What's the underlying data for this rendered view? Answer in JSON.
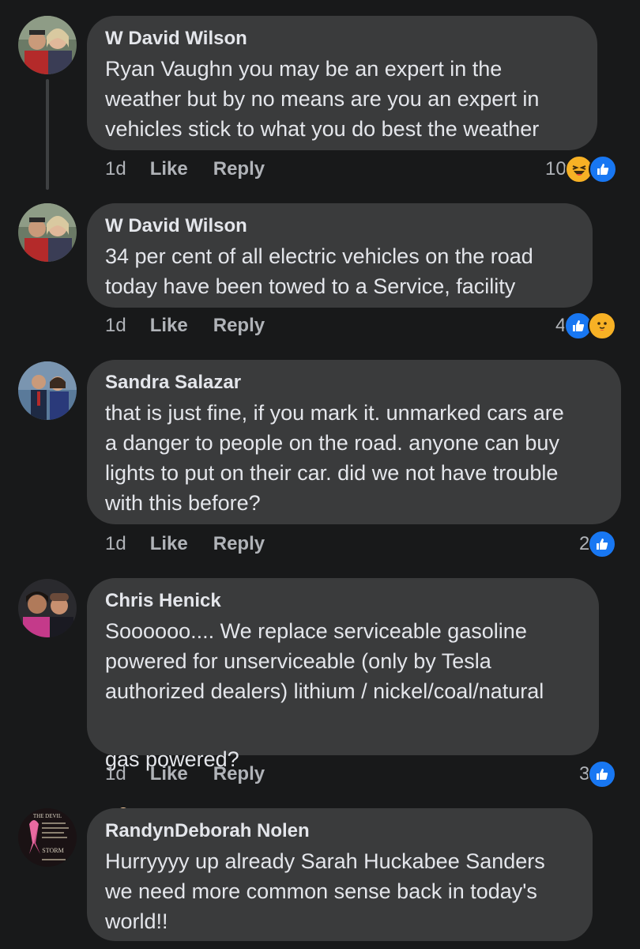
{
  "comments": [
    {
      "author": "W David Wilson",
      "text": "Ryan Vaughn you may be an expert in the\nweather but by no means are you an expert in\nvehicles stick to what you do best the weather",
      "time": "1d",
      "like_label": "Like",
      "reply_label": "Reply",
      "reaction_count": "10",
      "reactions": [
        "haha-icon",
        "like-icon"
      ]
    },
    {
      "author": "W David Wilson",
      "text": "34 per cent of all electric vehicles on the road\ntoday have been towed to a Service,  facility",
      "time": "1d",
      "like_label": "Like",
      "reply_label": "Reply",
      "reaction_count": "4",
      "reactions": [
        "like-icon",
        "care-icon"
      ]
    },
    {
      "author": "Sandra Salazar",
      "text": "that is just fine, if you mark it. unmarked cars are\na danger to people on the road. anyone can buy\nlights to put on their car. did we not have trouble\nwith this before?",
      "time": "1d",
      "like_label": "Like",
      "reply_label": "Reply",
      "reaction_count": "2",
      "reactions": [
        "like-icon"
      ]
    },
    {
      "author": "Chris Henick",
      "text": "Soooooo.... We replace serviceable gasoline\npowered for unserviceable (only by Tesla\nauthorized dealers) lithium / nickel/coal/natural",
      "text_last": "gas powered?",
      "time": "1d",
      "like_label": "Like",
      "reply_label": "Reply",
      "reaction_count": "3",
      "reactions": [
        "like-icon"
      ]
    },
    {
      "author": "RandynDeborah Nolen",
      "text": "Hurryyyy up already Sarah Huckabee Sanders\nwe need more common sense back in today's\nworld!!",
      "avatar_text": "THE DEVIL WHISPERED IN MY EAR ... I Am The STORM ... AWARENESS"
    }
  ],
  "colors": {
    "background": "#18191a",
    "bubble": "#3a3b3c",
    "text": "#e4e6eb",
    "secondary_text": "#b0b3b8",
    "like_blue": "#1877f2"
  }
}
